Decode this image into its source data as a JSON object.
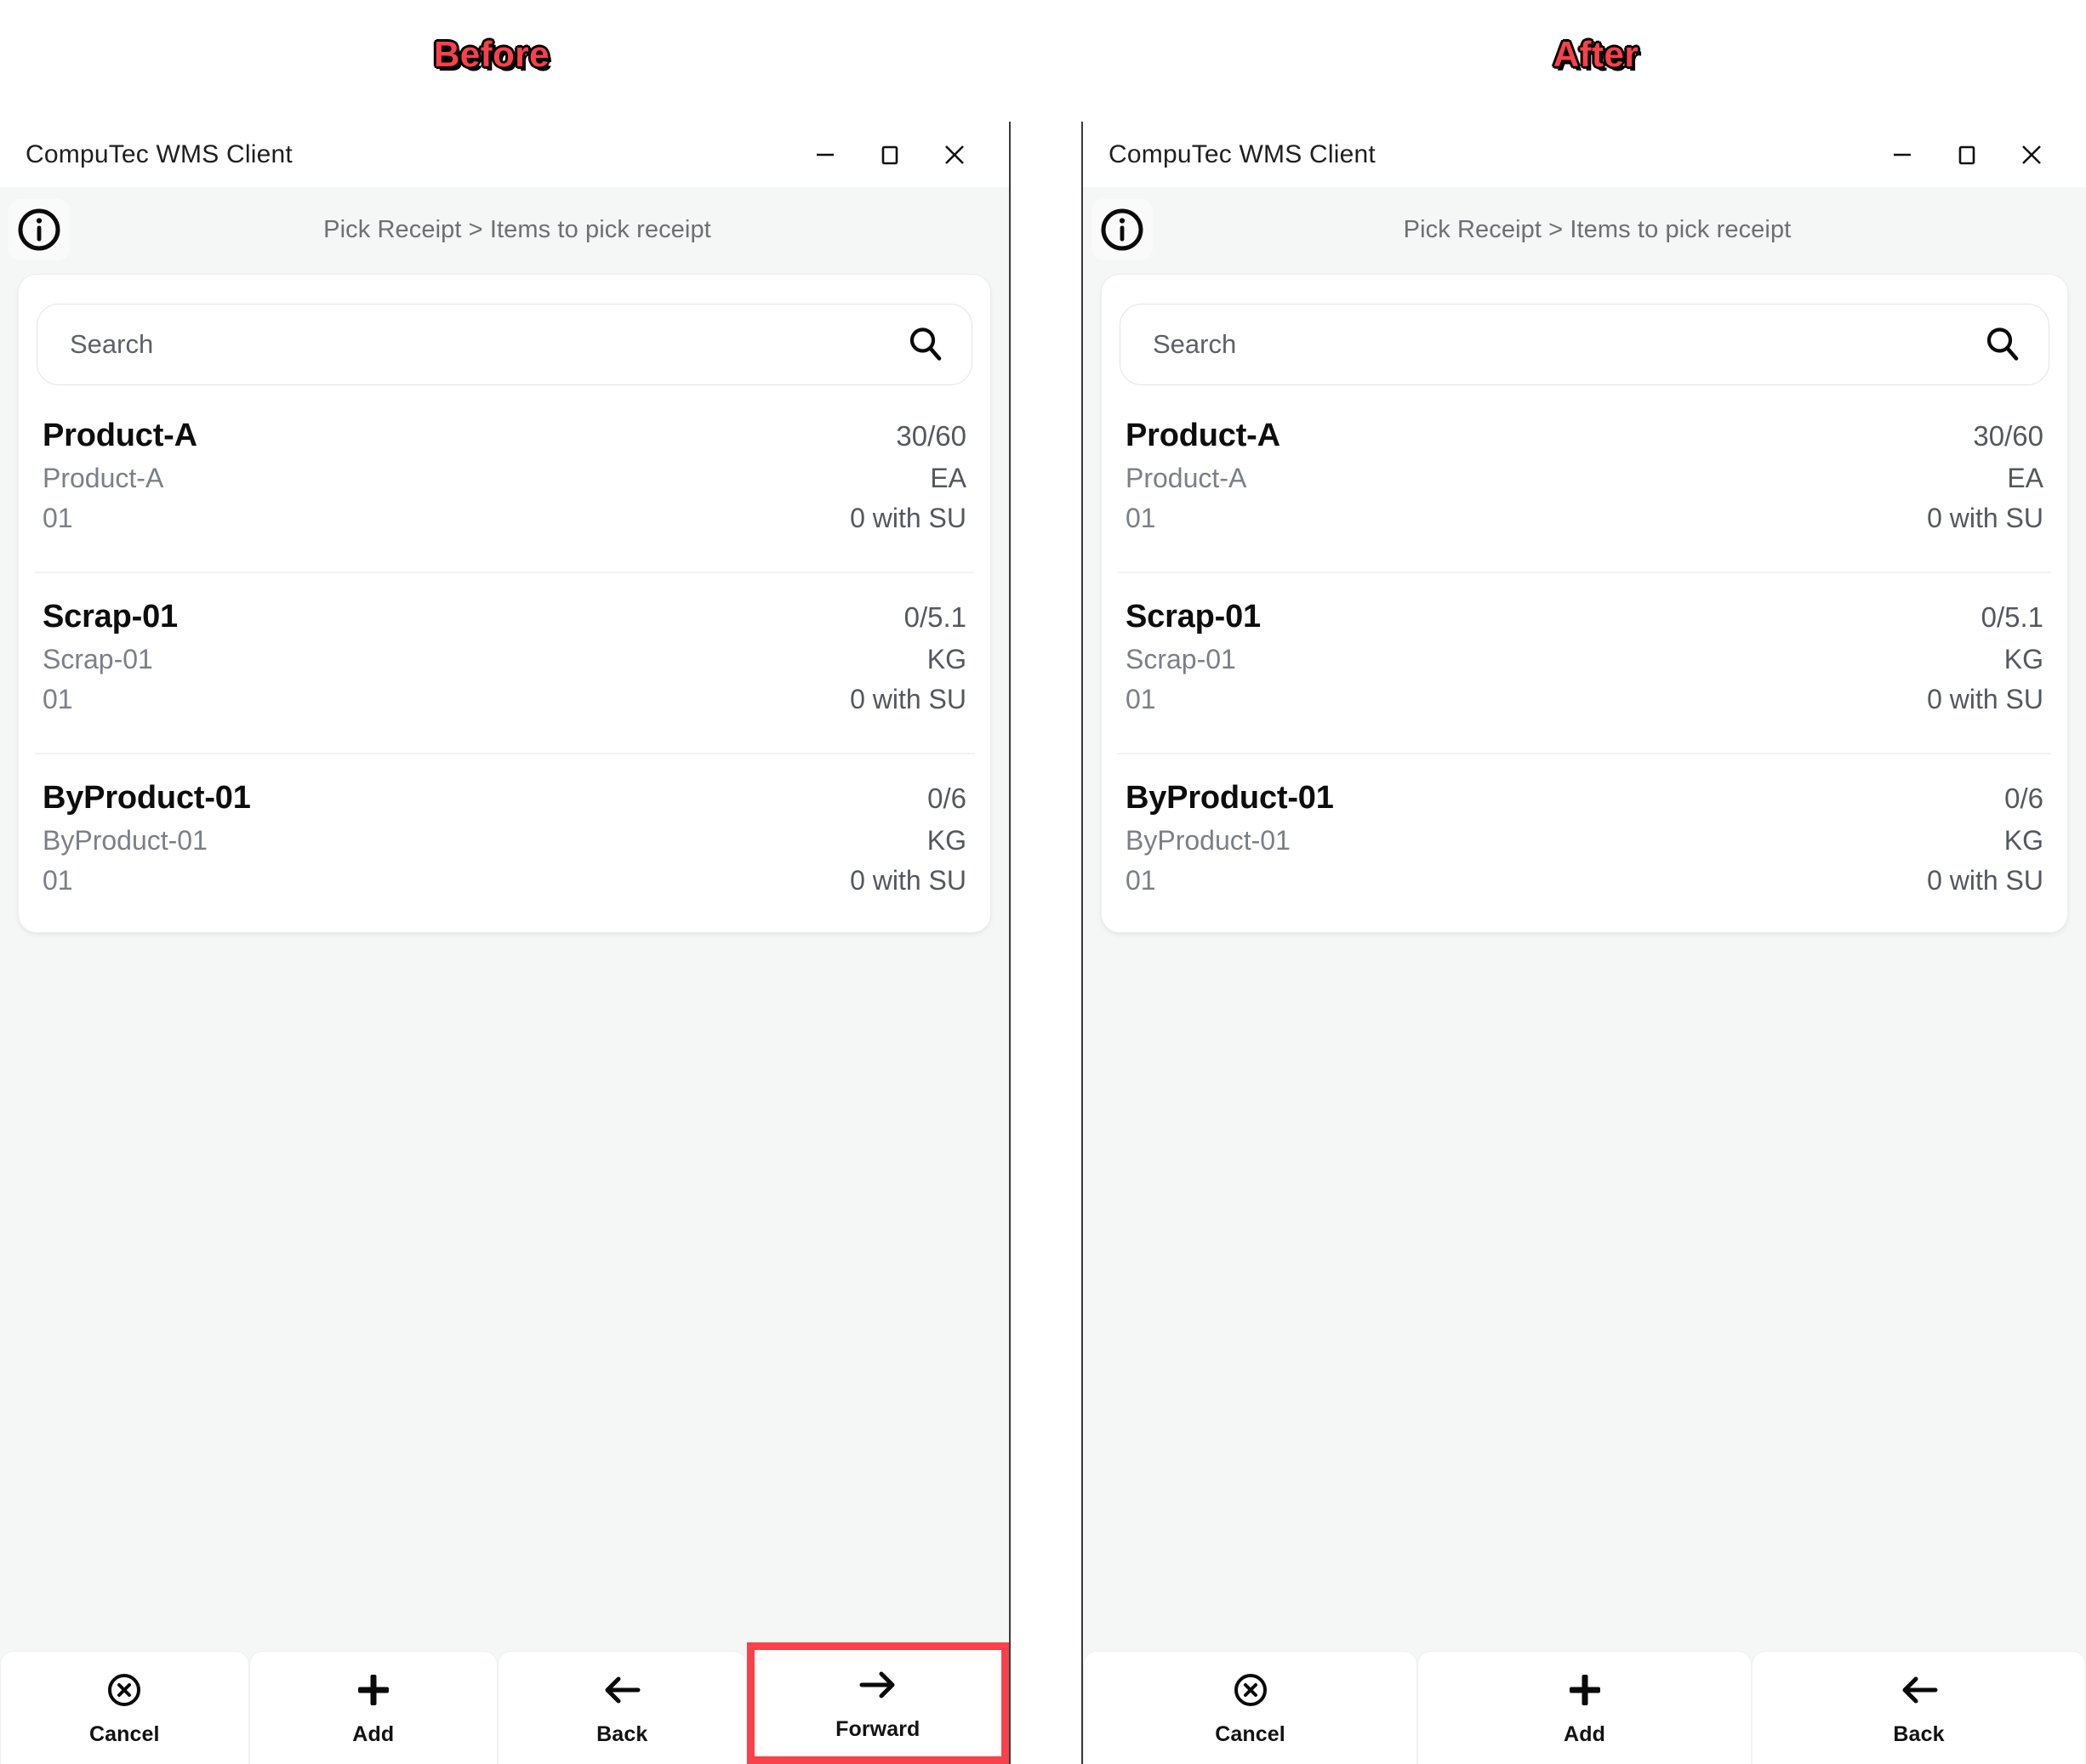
{
  "captions": {
    "before": "Before",
    "after": "After"
  },
  "window": {
    "title": "CompuTec WMS Client",
    "controls": {
      "minimize": "minimize-icon",
      "maximize": "maximize-icon",
      "close": "close-icon"
    }
  },
  "header": {
    "info_icon": "info-icon",
    "breadcrumb": "Pick Receipt > Items to pick receipt"
  },
  "search": {
    "placeholder": "Search",
    "value": "",
    "icon": "search-icon"
  },
  "items": [
    {
      "title": "Product-A",
      "quantity": "30/60",
      "subtitle": "Product-A",
      "unit": "EA",
      "line_code": "01",
      "su": "0 with SU"
    },
    {
      "title": "Scrap-01",
      "quantity": "0/5.1",
      "subtitle": "Scrap-01",
      "unit": "KG",
      "line_code": "01",
      "su": "0 with SU"
    },
    {
      "title": "ByProduct-01",
      "quantity": "0/6",
      "subtitle": "ByProduct-01",
      "unit": "KG",
      "line_code": "01",
      "su": "0 with SU"
    }
  ],
  "toolbar_before": [
    {
      "label": "Cancel",
      "icon": "cancel-circle-icon",
      "highlighted": false
    },
    {
      "label": "Add",
      "icon": "plus-icon",
      "highlighted": false
    },
    {
      "label": "Back",
      "icon": "arrow-left-icon",
      "highlighted": false
    },
    {
      "label": "Forward",
      "icon": "arrow-right-icon",
      "highlighted": true
    }
  ],
  "toolbar_after": [
    {
      "label": "Cancel",
      "icon": "cancel-circle-icon",
      "highlighted": false
    },
    {
      "label": "Add",
      "icon": "plus-icon",
      "highlighted": false
    },
    {
      "label": "Back",
      "icon": "arrow-left-icon",
      "highlighted": false
    }
  ],
  "colors": {
    "highlight_red": "#F8414A",
    "panel_background": "#F5F6F6",
    "card_background": "#FFFFFF",
    "title_text": "#0D0D0D",
    "muted_text": "#7B7F86"
  }
}
